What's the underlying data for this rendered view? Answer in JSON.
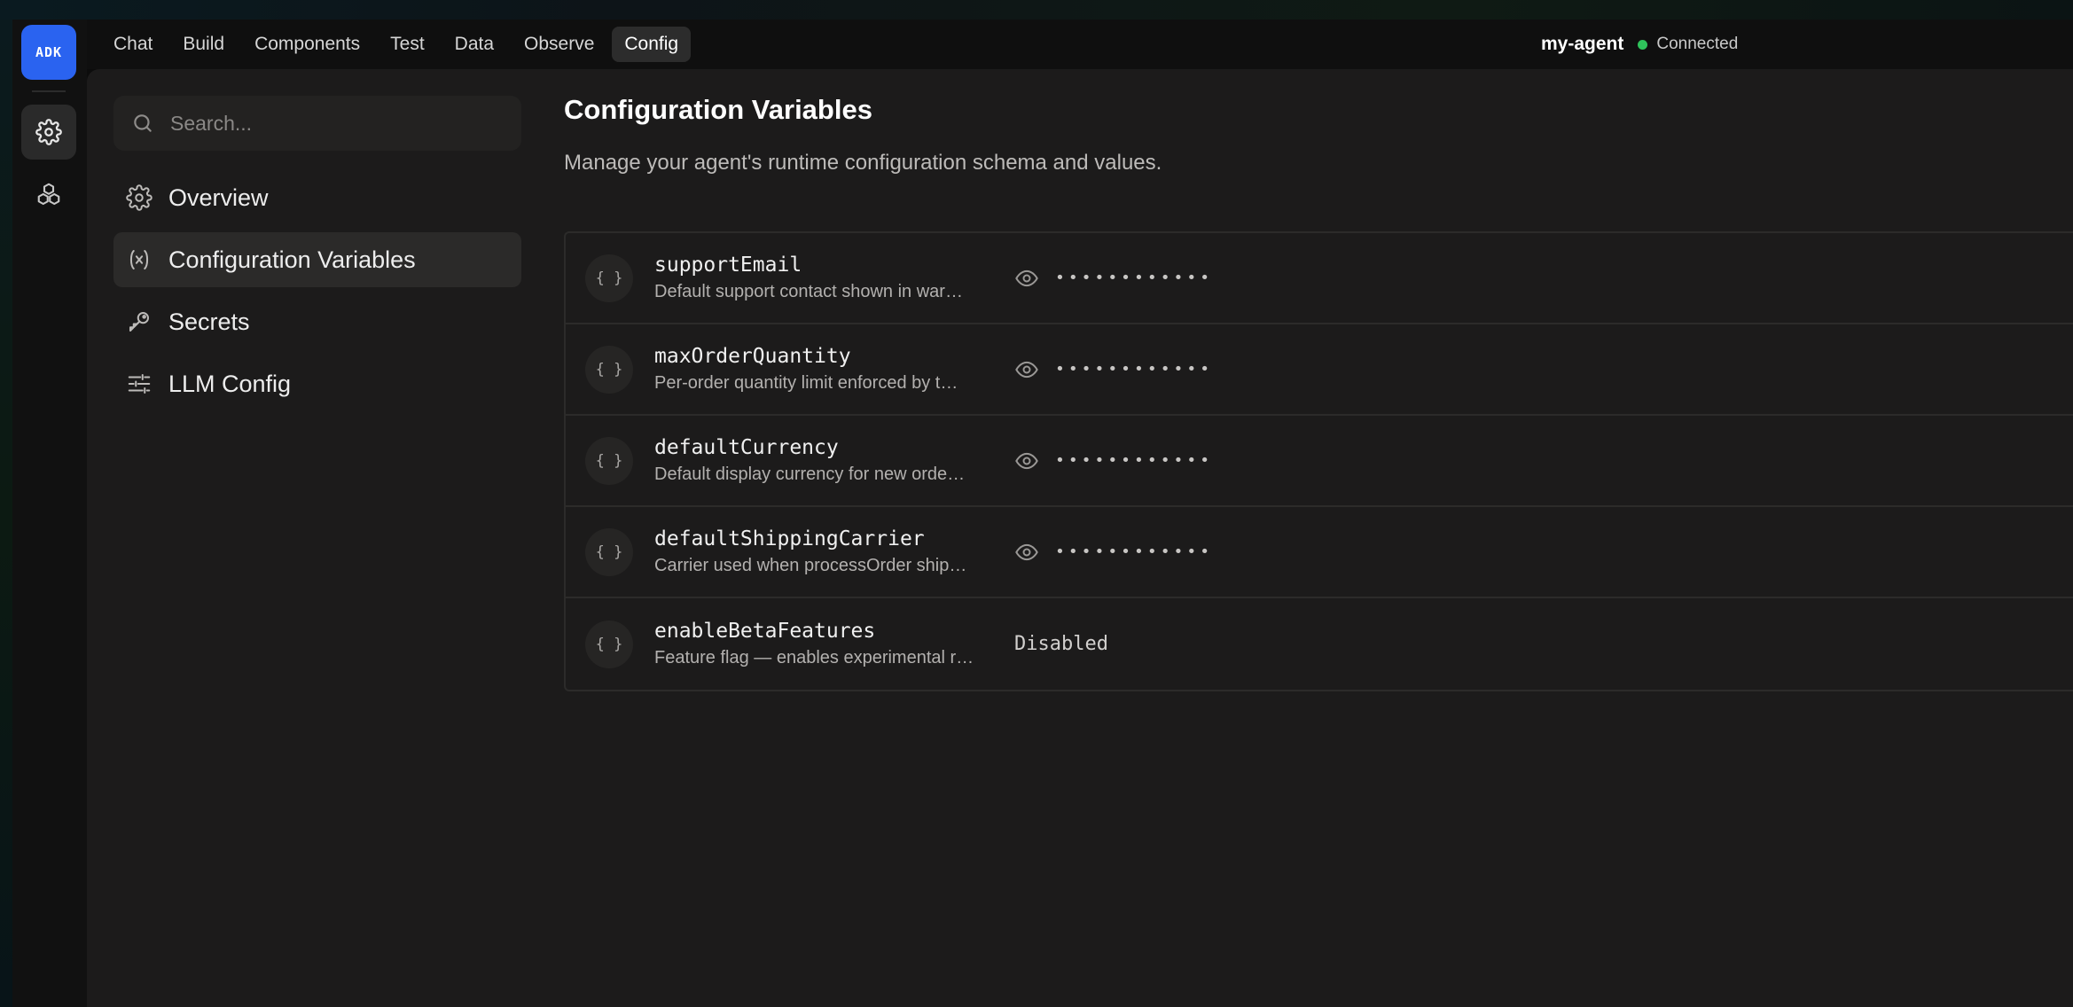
{
  "logo": {
    "text": "ADK"
  },
  "nav": {
    "tabs": [
      {
        "label": "Chat"
      },
      {
        "label": "Build"
      },
      {
        "label": "Components"
      },
      {
        "label": "Test"
      },
      {
        "label": "Data"
      },
      {
        "label": "Observe"
      },
      {
        "label": "Config",
        "active": true
      }
    ]
  },
  "agent": {
    "name": "my-agent",
    "status": "Connected",
    "status_color": "#2fc25b"
  },
  "sidebar": {
    "search_placeholder": "Search...",
    "items": [
      {
        "label": "Overview",
        "icon": "gear-icon"
      },
      {
        "label": "Configuration Variables",
        "icon": "variable-icon",
        "active": true
      },
      {
        "label": "Secrets",
        "icon": "key-icon"
      },
      {
        "label": "LLM Config",
        "icon": "sliders-icon"
      }
    ]
  },
  "content": {
    "title": "Configuration Variables",
    "subtitle": "Manage your agent's runtime configuration schema and values.",
    "variables": [
      {
        "badge": "{ }",
        "name": "supportEmail",
        "description": "Default support contact shown in war…",
        "value": "••••••••••••",
        "masked": true
      },
      {
        "badge": "{ }",
        "name": "maxOrderQuantity",
        "description": "Per-order quantity limit enforced by t…",
        "value": "••••••••••••",
        "masked": true
      },
      {
        "badge": "{ }",
        "name": "defaultCurrency",
        "description": "Default display currency for new orde…",
        "value": "••••••••••••",
        "masked": true
      },
      {
        "badge": "{ }",
        "name": "defaultShippingCarrier",
        "description": "Carrier used when processOrder ship…",
        "value": "••••••••••••",
        "masked": true
      },
      {
        "badge": "{ }",
        "name": "enableBetaFeatures",
        "description": "Feature flag — enables experimental r…",
        "value": "Disabled",
        "masked": false
      }
    ]
  },
  "colors": {
    "accent": "#2a63f0",
    "panel": "#1c1b1b"
  }
}
